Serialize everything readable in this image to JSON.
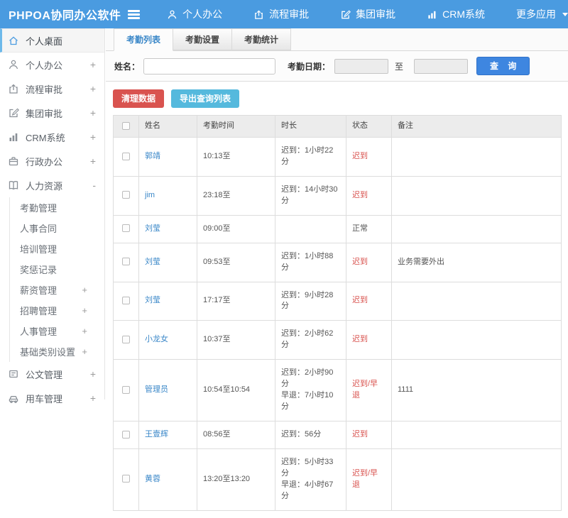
{
  "header": {
    "title": "PHPOA协同办公软件",
    "nav": [
      {
        "label": "个人办公",
        "icon": "person-icon"
      },
      {
        "label": "流程审批",
        "icon": "flow-icon"
      },
      {
        "label": "集团审批",
        "icon": "edit-icon"
      },
      {
        "label": "CRM系统",
        "icon": "chart-icon"
      },
      {
        "label": "更多应用",
        "icon": "caret-down-icon"
      }
    ]
  },
  "sidebar": {
    "items": [
      {
        "label": "个人桌面",
        "icon": "home-icon",
        "active": true
      },
      {
        "label": "个人办公",
        "icon": "person-icon",
        "expand": "+"
      },
      {
        "label": "流程审批",
        "icon": "flow-icon",
        "expand": "+"
      },
      {
        "label": "集团审批",
        "icon": "edit-icon",
        "expand": "+"
      },
      {
        "label": "CRM系统",
        "icon": "chart-icon",
        "expand": "+"
      },
      {
        "label": "行政办公",
        "icon": "briefcase-icon",
        "expand": "+"
      },
      {
        "label": "人力资源",
        "icon": "book-icon",
        "expand": "-"
      },
      {
        "label": "公文管理",
        "icon": "document-icon",
        "expand": "+"
      },
      {
        "label": "用车管理",
        "icon": "car-icon",
        "expand": "+"
      }
    ],
    "hr_children": [
      {
        "label": "考勤管理",
        "expand": ""
      },
      {
        "label": "人事合同",
        "expand": ""
      },
      {
        "label": "培训管理",
        "expand": ""
      },
      {
        "label": "奖惩记录",
        "expand": ""
      },
      {
        "label": "薪资管理",
        "expand": "+"
      },
      {
        "label": "招聘管理",
        "expand": "+"
      },
      {
        "label": "人事管理",
        "expand": "+"
      },
      {
        "label": "基础类别设置",
        "expand": "+"
      }
    ]
  },
  "tabs": [
    {
      "label": "考勤列表",
      "active": true
    },
    {
      "label": "考勤设置",
      "active": false
    },
    {
      "label": "考勤统计",
      "active": false
    }
  ],
  "filter": {
    "name_label": "姓名：",
    "date_label": "考勤日期：",
    "to_label": "至",
    "search_button": "查 询",
    "name_value": "",
    "date_from_value": "",
    "date_to_value": ""
  },
  "actions": {
    "clear_button": "清理数据",
    "export_button": "导出查询列表"
  },
  "table": {
    "columns": {
      "name": "姓名",
      "time": "考勤时间",
      "duration": "时长",
      "status": "状态",
      "remark": "备注"
    },
    "rows": [
      {
        "name": "郭靖",
        "time": "10:13至",
        "duration1": "迟到：1小时22分",
        "duration2": "",
        "status": "迟到",
        "status_class": "st-red",
        "remark": ""
      },
      {
        "name": "jim",
        "time": "23:18至",
        "duration1": "迟到：14小时30分",
        "duration2": "",
        "status": "迟到",
        "status_class": "st-red",
        "remark": ""
      },
      {
        "name": "刘莹",
        "time": "09:00至",
        "duration1": "",
        "duration2": "",
        "status": "正常",
        "status_class": "st-normal",
        "remark": ""
      },
      {
        "name": "刘莹",
        "time": "09:53至",
        "duration1": "迟到：1小时88分",
        "duration2": "",
        "status": "迟到",
        "status_class": "st-red",
        "remark": "业务需要外出"
      },
      {
        "name": "刘莹",
        "time": "17:17至",
        "duration1": "迟到：9小时28分",
        "duration2": "",
        "status": "迟到",
        "status_class": "st-red",
        "remark": ""
      },
      {
        "name": "小龙女",
        "time": "10:37至",
        "duration1": "迟到：2小时62分",
        "duration2": "",
        "status": "迟到",
        "status_class": "st-red",
        "remark": ""
      },
      {
        "name": "管理员",
        "time": "10:54至10:54",
        "duration1": "迟到：2小时90分",
        "duration2": "早退：7小时10分",
        "status": "迟到/早退",
        "status_class": "st-red",
        "remark": "1111"
      },
      {
        "name": "王壹辉",
        "time": "08:56至",
        "duration1": "迟到：56分",
        "duration2": "",
        "status": "迟到",
        "status_class": "st-red",
        "remark": ""
      },
      {
        "name": "黄蓉",
        "time": "13:20至13:20",
        "duration1": "迟到：5小时33分",
        "duration2": "早退：4小时67分",
        "status": "迟到/早退",
        "status_class": "st-red",
        "remark": ""
      }
    ]
  },
  "colors": {
    "topbar_blue": "#4a9be0",
    "link_blue": "#3a87c8",
    "status_red": "#d9534f",
    "button_red": "#d9534f",
    "button_cyan": "#55b9dd",
    "button_blue": "#3e86e0"
  }
}
